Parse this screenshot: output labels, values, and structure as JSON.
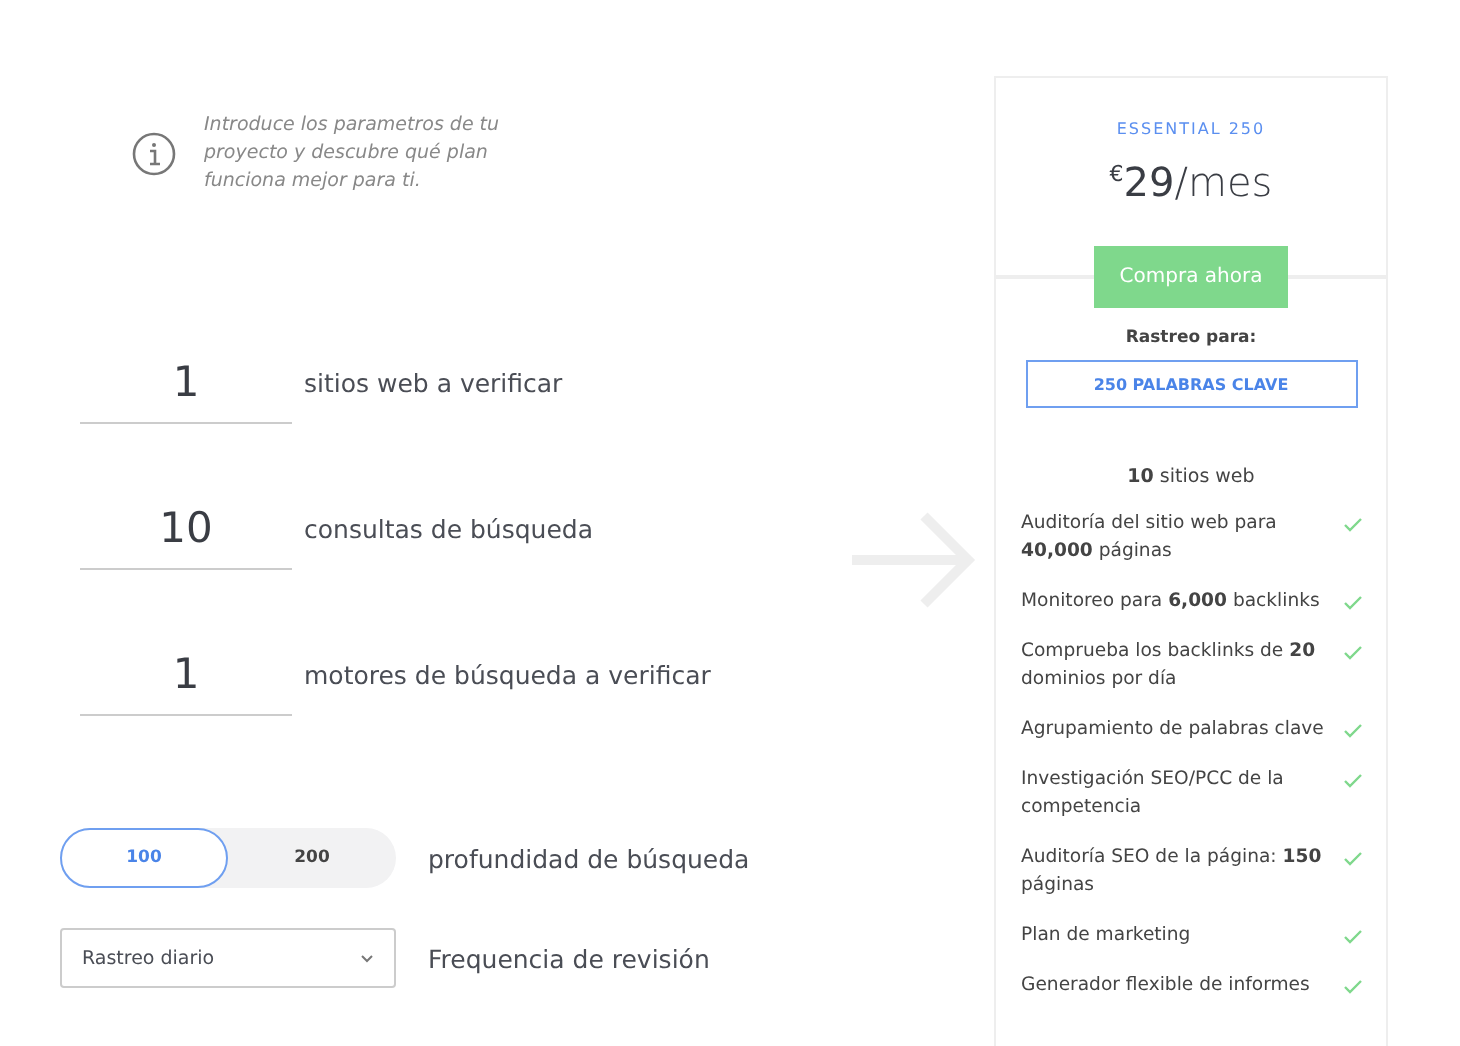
{
  "intro": "Introduce los parametros de tu proyecto y descubre qué plan funciona mejor para ti.",
  "params": [
    {
      "value": "1",
      "label": "sitios web a verificar"
    },
    {
      "value": "10",
      "label": "consultas de búsqueda"
    },
    {
      "value": "1",
      "label": "motores de búsqueda a verificar"
    }
  ],
  "depth": {
    "options": [
      {
        "label": "100",
        "selected": true
      },
      {
        "label": "200",
        "selected": false
      }
    ],
    "label": "profundidad de búsqueda"
  },
  "frequency": {
    "value": "Rastreo diario",
    "label": "Frequencia de revisión"
  },
  "plan": {
    "name": "ESSENTIAL 250",
    "currency": "€",
    "price": "29",
    "period": "/mes",
    "buy": "Compra ahora",
    "tracking_label": "Rastreo para:",
    "keywords": "250 PALABRAS CLAVE",
    "sites": "**10** sitios web",
    "features": [
      {
        "text": "Auditoría del sitio web para **40,000** páginas",
        "included": true
      },
      {
        "text": "Monitoreo para **6,000** backlinks",
        "included": true
      },
      {
        "text": "Comprueba los backlinks de **20** dominios por día",
        "included": true
      },
      {
        "text": "Agrupamiento de palabras clave",
        "included": true
      },
      {
        "text": "Investigación SEO/PCC de la competencia",
        "included": true
      },
      {
        "text": "Auditoría SEO de la página: **150** páginas",
        "included": true
      },
      {
        "text": "Plan de marketing",
        "included": true
      },
      {
        "text": "Generador flexible de informes",
        "included": true
      }
    ]
  }
}
